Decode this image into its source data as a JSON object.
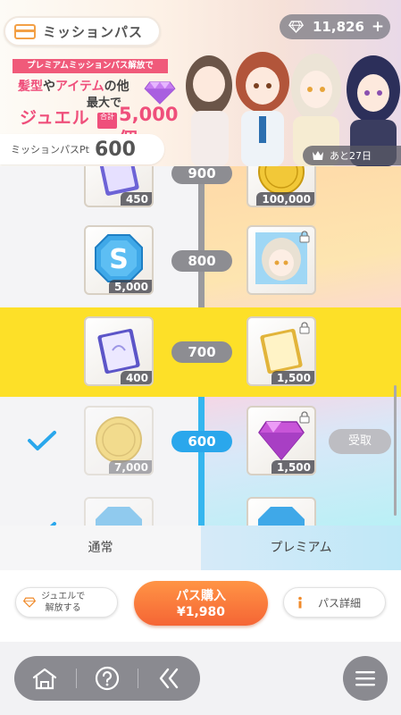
{
  "header": {
    "pass_title": "ミッションパス",
    "jewel_count": "11,826",
    "jewel_plus": "+",
    "promo": {
      "banner": "プレミアムミッションパス解放で",
      "line1_a": "髪型",
      "line1_b": "や",
      "line1_c": "アイテム",
      "line1_d": "の他",
      "line2": "最大で",
      "line3": "ジュエル",
      "total_label": "合計",
      "amount": "5,000個"
    },
    "days_left": "あと27日",
    "pass_pt_label": "ミッションパスPt",
    "pass_pt_value": "600"
  },
  "rows": [
    {
      "level": "900",
      "reached": false,
      "highlight": false,
      "left_qty": "450",
      "right_qty": "100,000",
      "right_locked": false,
      "claim": ""
    },
    {
      "level": "800",
      "reached": false,
      "highlight": false,
      "left_qty": "5,000",
      "right_qty": "",
      "right_locked": true,
      "claim": ""
    },
    {
      "level": "700",
      "reached": false,
      "highlight": true,
      "left_qty": "400",
      "right_qty": "1,500",
      "right_locked": true,
      "claim": ""
    },
    {
      "level": "600",
      "reached": true,
      "highlight": false,
      "left_qty": "7,000",
      "right_qty": "1,500",
      "right_locked": true,
      "claim": "受取"
    }
  ],
  "tabs": {
    "normal": "通常",
    "premium": "プレミアム"
  },
  "actions": {
    "jewel_unlock": "ジュエルで\n解放する",
    "buy_line1": "パス購入",
    "buy_line2": "¥1,980",
    "detail": "パス詳細"
  },
  "nav": {
    "home_icon": "home-icon",
    "help_icon": "help-icon",
    "back_icon": "back-icon",
    "menu_icon": "menu-icon"
  },
  "colors": {
    "highlight": "#fde028",
    "active": "#2aa7ec",
    "buy": "#f56535",
    "pink": "#ef4f7b"
  }
}
